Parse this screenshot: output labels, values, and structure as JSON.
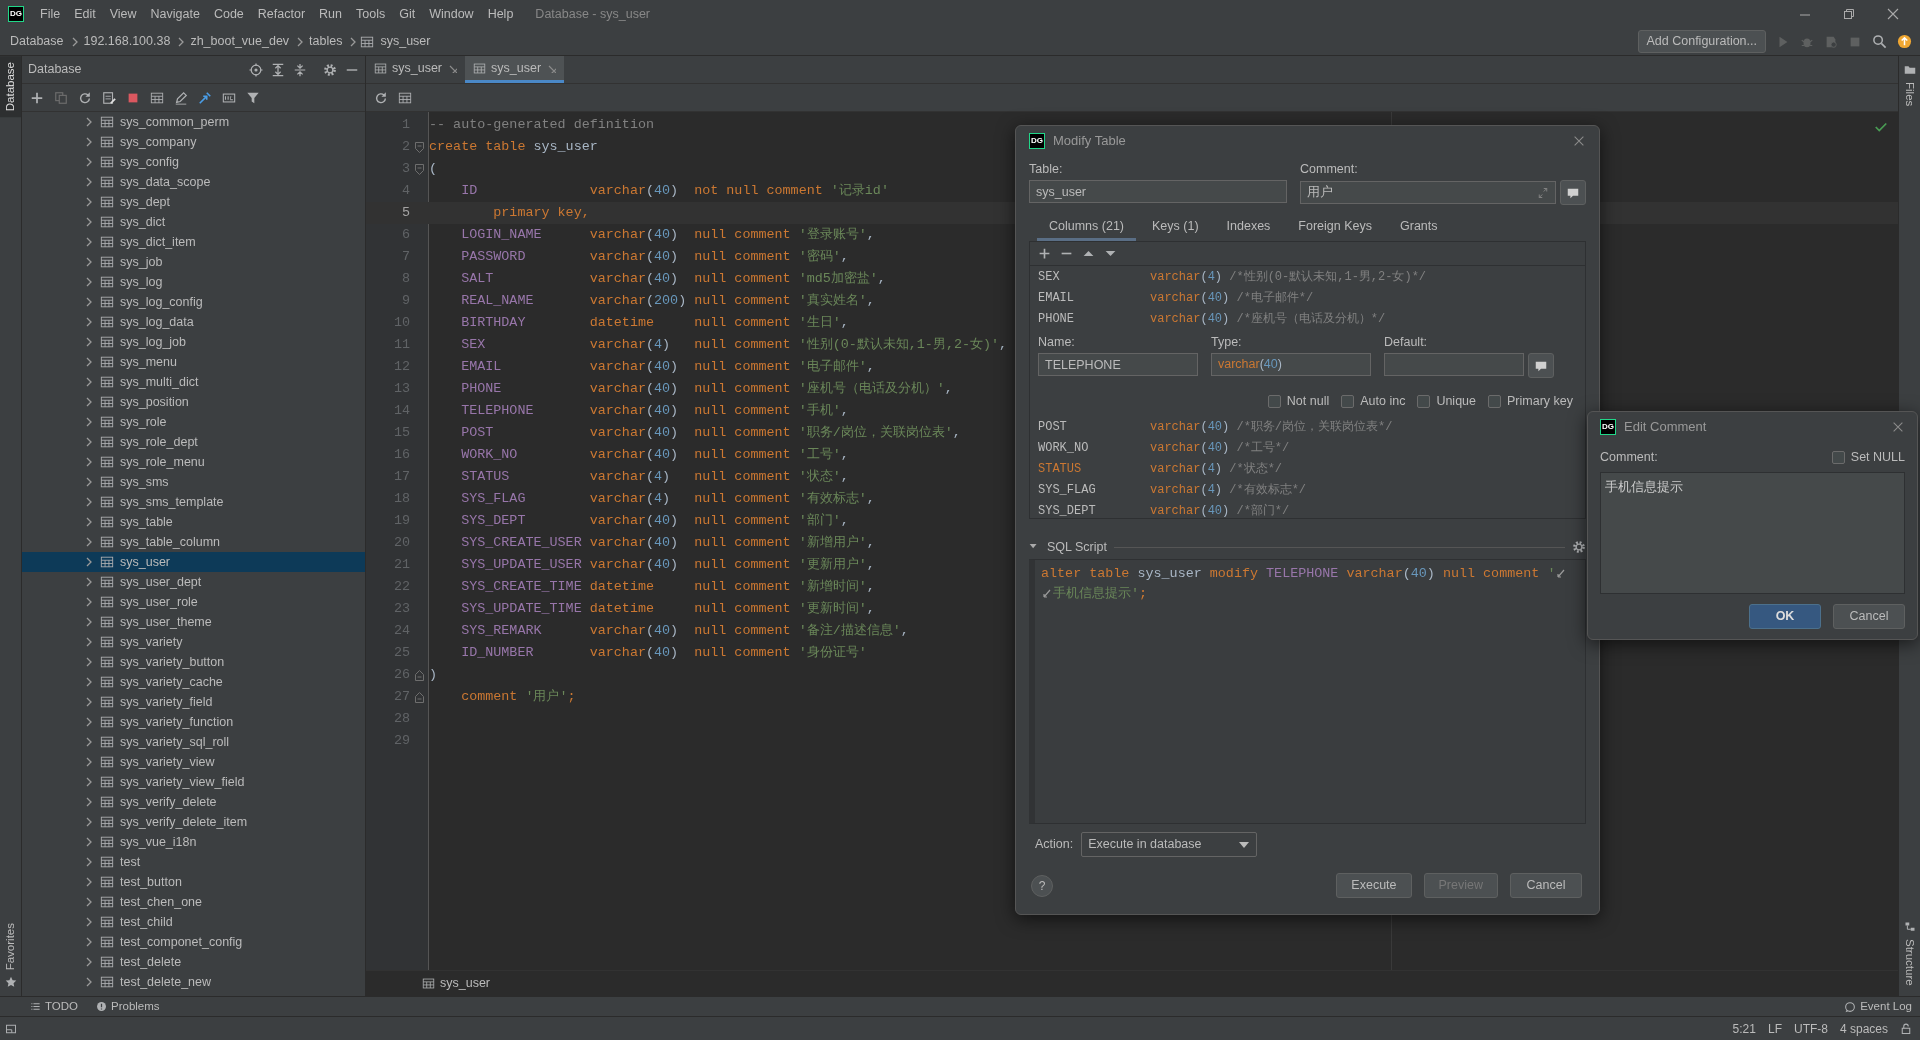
{
  "window": {
    "logo": "DG",
    "title": "Database - sys_user",
    "menu": [
      "File",
      "Edit",
      "View",
      "Navigate",
      "Code",
      "Refactor",
      "Run",
      "Tools",
      "Git",
      "Window",
      "Help"
    ]
  },
  "breadcrumb": [
    "Database",
    "192.168.100.38",
    "zh_boot_vue_dev",
    "tables",
    "sys_user"
  ],
  "toolbar": {
    "run_configuration": "Add Configuration..."
  },
  "left_stripe": [
    {
      "label": "Database",
      "selected": true
    },
    {
      "label": "Favorites",
      "selected": false
    }
  ],
  "right_stripe": [
    {
      "label": "Files"
    },
    {
      "label": "Structure"
    }
  ],
  "database_panel": {
    "title": "Database",
    "tree": [
      {
        "label": "sys_common_perm",
        "selected": false
      },
      {
        "label": "sys_company",
        "selected": false
      },
      {
        "label": "sys_config",
        "selected": false
      },
      {
        "label": "sys_data_scope",
        "selected": false
      },
      {
        "label": "sys_dept",
        "selected": false
      },
      {
        "label": "sys_dict",
        "selected": false
      },
      {
        "label": "sys_dict_item",
        "selected": false
      },
      {
        "label": "sys_job",
        "selected": false
      },
      {
        "label": "sys_log",
        "selected": false
      },
      {
        "label": "sys_log_config",
        "selected": false
      },
      {
        "label": "sys_log_data",
        "selected": false
      },
      {
        "label": "sys_log_job",
        "selected": false
      },
      {
        "label": "sys_menu",
        "selected": false
      },
      {
        "label": "sys_multi_dict",
        "selected": false
      },
      {
        "label": "sys_position",
        "selected": false
      },
      {
        "label": "sys_role",
        "selected": false
      },
      {
        "label": "sys_role_dept",
        "selected": false
      },
      {
        "label": "sys_role_menu",
        "selected": false
      },
      {
        "label": "sys_sms",
        "selected": false
      },
      {
        "label": "sys_sms_template",
        "selected": false
      },
      {
        "label": "sys_table",
        "selected": false
      },
      {
        "label": "sys_table_column",
        "selected": false
      },
      {
        "label": "sys_user",
        "selected": true
      },
      {
        "label": "sys_user_dept",
        "selected": false
      },
      {
        "label": "sys_user_role",
        "selected": false
      },
      {
        "label": "sys_user_theme",
        "selected": false
      },
      {
        "label": "sys_variety",
        "selected": false
      },
      {
        "label": "sys_variety_button",
        "selected": false
      },
      {
        "label": "sys_variety_cache",
        "selected": false
      },
      {
        "label": "sys_variety_field",
        "selected": false
      },
      {
        "label": "sys_variety_function",
        "selected": false
      },
      {
        "label": "sys_variety_sql_roll",
        "selected": false
      },
      {
        "label": "sys_variety_view",
        "selected": false
      },
      {
        "label": "sys_variety_view_field",
        "selected": false
      },
      {
        "label": "sys_verify_delete",
        "selected": false
      },
      {
        "label": "sys_verify_delete_item",
        "selected": false
      },
      {
        "label": "sys_vue_i18n",
        "selected": false
      },
      {
        "label": "test",
        "selected": false
      },
      {
        "label": "test_button",
        "selected": false
      },
      {
        "label": "test_chen_one",
        "selected": false
      },
      {
        "label": "test_child",
        "selected": false
      },
      {
        "label": "test_componet_config",
        "selected": false
      },
      {
        "label": "test_delete",
        "selected": false
      },
      {
        "label": "test_delete_new",
        "selected": false
      }
    ]
  },
  "editor": {
    "tabs": [
      {
        "label": "sys_user",
        "selected": false
      },
      {
        "label": "sys_user",
        "selected": true
      }
    ],
    "lines": [
      {
        "number": "1",
        "kind": "comment",
        "text": "-- auto-generated definition",
        "current": false
      },
      {
        "number": "2",
        "kind": "create",
        "keyword": "create table",
        "name": "sys_user",
        "fold": true,
        "current": false
      },
      {
        "number": "3",
        "kind": "paren",
        "text": "(",
        "fold": true,
        "current": false
      },
      {
        "number": "4",
        "kind": "column",
        "name": "ID",
        "type": "varchar",
        "open": "(",
        "size": "40",
        "close": ")",
        "constraint": "not null comment",
        "comment": "'记录id'",
        "current": false
      },
      {
        "number": "5",
        "kind": "keyword",
        "text": "primary key,",
        "current": true
      },
      {
        "number": "6",
        "kind": "column",
        "name": "LOGIN_NAME",
        "type": "varchar",
        "open": "(",
        "size": "40",
        "close": ")",
        "constraint": "null comment",
        "comment": "'登录账号'",
        "end": ",",
        "current": false
      },
      {
        "number": "7",
        "kind": "column",
        "name": "PASSWORD",
        "type": "varchar",
        "open": "(",
        "size": "40",
        "close": ")",
        "constraint": "null comment",
        "comment": "'密码'",
        "end": ",",
        "current": false
      },
      {
        "number": "8",
        "kind": "column",
        "name": "SALT",
        "type": "varchar",
        "open": "(",
        "size": "40",
        "close": ")",
        "constraint": "null comment",
        "comment": "'md5加密盐'",
        "end": ",",
        "current": false
      },
      {
        "number": "9",
        "kind": "column",
        "name": "REAL_NAME",
        "type": "varchar",
        "open": "(",
        "size": "200",
        "close": ")",
        "constraint": "null comment",
        "comment": "'真实姓名'",
        "end": ",",
        "current": false
      },
      {
        "number": "10",
        "kind": "column",
        "name": "BIRTHDAY",
        "type": "datetime",
        "constraint": "null comment",
        "comment": "'生日'",
        "end": ",",
        "current": false
      },
      {
        "number": "11",
        "kind": "column",
        "name": "SEX",
        "type": "varchar",
        "open": "(",
        "size": "4",
        "close": ")",
        "constraint": "null comment",
        "comment": "'性别(0-默认未知,1-男,2-女)'",
        "end": ",",
        "current": false
      },
      {
        "number": "12",
        "kind": "column",
        "name": "EMAIL",
        "type": "varchar",
        "open": "(",
        "size": "40",
        "close": ")",
        "constraint": "null comment",
        "comment": "'电子邮件'",
        "end": ",",
        "current": false
      },
      {
        "number": "13",
        "kind": "column",
        "name": "PHONE",
        "type": "varchar",
        "open": "(",
        "size": "40",
        "close": ")",
        "constraint": "null comment",
        "comment": "'座机号（电话及分机）'",
        "end": ",",
        "current": false
      },
      {
        "number": "14",
        "kind": "column",
        "name": "TELEPHONE",
        "type": "varchar",
        "open": "(",
        "size": "40",
        "close": ")",
        "constraint": "null comment",
        "comment": "'手机'",
        "end": ",",
        "current": false
      },
      {
        "number": "15",
        "kind": "column",
        "name": "POST",
        "type": "varchar",
        "open": "(",
        "size": "40",
        "close": ")",
        "constraint": "null comment",
        "comment": "'职务/岗位，关联岗位表'",
        "end": ",",
        "current": false
      },
      {
        "number": "16",
        "kind": "column",
        "name": "WORK_NO",
        "type": "varchar",
        "open": "(",
        "size": "40",
        "close": ")",
        "constraint": "null comment",
        "comment": "'工号'",
        "end": ",",
        "current": false
      },
      {
        "number": "17",
        "kind": "column",
        "name": "STATUS",
        "type": "varchar",
        "open": "(",
        "size": "4",
        "close": ")",
        "constraint": "null comment",
        "comment": "'状态'",
        "end": ",",
        "current": false
      },
      {
        "number": "18",
        "kind": "column",
        "name": "SYS_FLAG",
        "type": "varchar",
        "open": "(",
        "size": "4",
        "close": ")",
        "constraint": "null comment",
        "comment": "'有效标志'",
        "end": ",",
        "current": false
      },
      {
        "number": "19",
        "kind": "column",
        "name": "SYS_DEPT",
        "type": "varchar",
        "open": "(",
        "size": "40",
        "close": ")",
        "constraint": "null comment",
        "comment": "'部门'",
        "end": ",",
        "current": false
      },
      {
        "number": "20",
        "kind": "column",
        "name": "SYS_CREATE_USER",
        "type": "varchar",
        "open": "(",
        "size": "40",
        "close": ")",
        "constraint": "null comment",
        "comment": "'新增用户'",
        "end": ",",
        "current": false
      },
      {
        "number": "21",
        "kind": "column",
        "name": "SYS_UPDATE_USER",
        "type": "varchar",
        "open": "(",
        "size": "40",
        "close": ")",
        "constraint": "null comment",
        "comment": "'更新用户'",
        "end": ",",
        "current": false
      },
      {
        "number": "22",
        "kind": "column",
        "name": "SYS_CREATE_TIME",
        "type": "datetime",
        "constraint": "null comment",
        "comment": "'新增时间'",
        "end": ",",
        "current": false
      },
      {
        "number": "23",
        "kind": "column",
        "name": "SYS_UPDATE_TIME",
        "type": "datetime",
        "constraint": "null comment",
        "comment": "'更新时间'",
        "end": ",",
        "current": false
      },
      {
        "number": "24",
        "kind": "column",
        "name": "SYS_REMARK",
        "type": "varchar",
        "open": "(",
        "size": "40",
        "close": ")",
        "constraint": "null comment",
        "comment": "'备注/描述信息'",
        "end": ",",
        "current": false
      },
      {
        "number": "25",
        "kind": "column",
        "name": "ID_NUMBER",
        "type": "varchar",
        "open": "(",
        "size": "40",
        "close": ")",
        "constraint": "null comment",
        "comment": "'身份证号'",
        "current": false
      },
      {
        "number": "26",
        "kind": "paren",
        "text": ")",
        "fold": true,
        "current": false
      },
      {
        "number": "27",
        "kind": "table_comment",
        "keyword": "comment",
        "comment": "'用户'",
        "end": ";",
        "fold": true,
        "current": false
      },
      {
        "number": "28",
        "kind": "blank",
        "current": false
      },
      {
        "number": "29",
        "kind": "blank",
        "current": false
      }
    ],
    "breadcrumb": "sys_user"
  },
  "modify_table": {
    "logo": "DG",
    "title": "Modify Table",
    "table_label": "Table:",
    "table": "sys_user",
    "comment_label": "Comment:",
    "comment": "用户",
    "tabs": [
      {
        "label": "Columns (21)",
        "selected": true
      },
      {
        "label": "Keys (1)",
        "selected": false
      },
      {
        "label": "Indexes",
        "selected": false
      },
      {
        "label": "Foreign Keys",
        "selected": false
      },
      {
        "label": "Grants",
        "selected": false
      }
    ],
    "columns_above": [
      {
        "name": "SEX",
        "type": "varchar",
        "open": "(",
        "size": "4",
        "close": ")",
        "comment": "/*性别(0-默认未知,1-男,2-女)*/",
        "modified": false
      },
      {
        "name": "EMAIL",
        "type": "varchar",
        "open": "(",
        "size": "40",
        "close": ")",
        "comment": "/*电子邮件*/",
        "modified": false
      },
      {
        "name": "PHONE",
        "type": "varchar",
        "open": "(",
        "size": "40",
        "close": ")",
        "comment": "/*座机号（电话及分机）*/",
        "modified": false
      }
    ],
    "column_editor": {
      "name_label": "Name:",
      "name": "TELEPHONE",
      "type_label": "Type:",
      "type": "varchar",
      "open": "(",
      "size": "40",
      "close": ")",
      "default_label": "Default:",
      "options": [
        {
          "label": "Not null",
          "checked": false
        },
        {
          "label": "Auto inc",
          "checked": false
        },
        {
          "label": "Unique",
          "checked": false
        },
        {
          "label": "Primary key",
          "checked": false
        }
      ]
    },
    "columns_below": [
      {
        "name": "POST",
        "type": "varchar",
        "open": "(",
        "size": "40",
        "close": ")",
        "comment": "/*职务/岗位，关联岗位表*/",
        "modified": false
      },
      {
        "name": "WORK_NO",
        "type": "varchar",
        "open": "(",
        "size": "40",
        "close": ")",
        "comment": "/*工号*/",
        "modified": false
      },
      {
        "name": "STATUS",
        "type": "varchar",
        "open": "(",
        "size": "4",
        "close": ")",
        "comment": "/*状态*/",
        "modified": true
      },
      {
        "name": "SYS_FLAG",
        "type": "varchar",
        "open": "(",
        "size": "4",
        "close": ")",
        "comment": "/*有效标志*/",
        "modified": false
      },
      {
        "name": "SYS_DEPT",
        "type": "varchar",
        "open": "(",
        "size": "40",
        "close": ")",
        "comment": "/*部门*/",
        "modified": false
      }
    ],
    "sql_script": {
      "title": "SQL Script",
      "expanded": true,
      "lines": [
        {
          "soft_wrapped": true,
          "tokens": [
            {
              "kind": "keyword",
              "text": "alter table"
            },
            {
              "kind": "plain",
              "text": "sys_user"
            },
            {
              "kind": "keyword",
              "text": "modify"
            },
            {
              "kind": "column",
              "text": "TELEPHONE"
            },
            {
              "kind": "keyword",
              "text": "varchar"
            },
            {
              "kind": "punct",
              "text": "("
            },
            {
              "kind": "number",
              "text": "40"
            },
            {
              "kind": "punct",
              "text": ")"
            },
            {
              "kind": "keyword",
              "text": "null comment"
            },
            {
              "kind": "string",
              "text": "'"
            }
          ]
        },
        {
          "soft_wrapped": false,
          "tokens": [
            {
              "kind": "string",
              "text": "手机信息提示'"
            },
            {
              "kind": "keyword",
              "text": ";"
            }
          ]
        }
      ]
    },
    "action_label": "Action:",
    "action": "Execute in database",
    "help": "?",
    "buttons": [
      {
        "label": "Execute",
        "disabled": false
      },
      {
        "label": "Preview",
        "disabled": true
      },
      {
        "label": "Cancel",
        "disabled": false
      }
    ]
  },
  "edit_comment": {
    "logo": "DG",
    "title": "Edit Comment",
    "comment_label": "Comment:",
    "set_null": {
      "label": "Set NULL",
      "checked": false
    },
    "value": "手机信息提示",
    "buttons": [
      {
        "label": "OK",
        "primary": true
      },
      {
        "label": "Cancel",
        "primary": false
      }
    ]
  },
  "tool_windows": [
    "TODO",
    "Problems"
  ],
  "event_log": "Event Log",
  "status_bar": [
    "5:21",
    "LF",
    "UTF-8",
    "4 spaces"
  ]
}
